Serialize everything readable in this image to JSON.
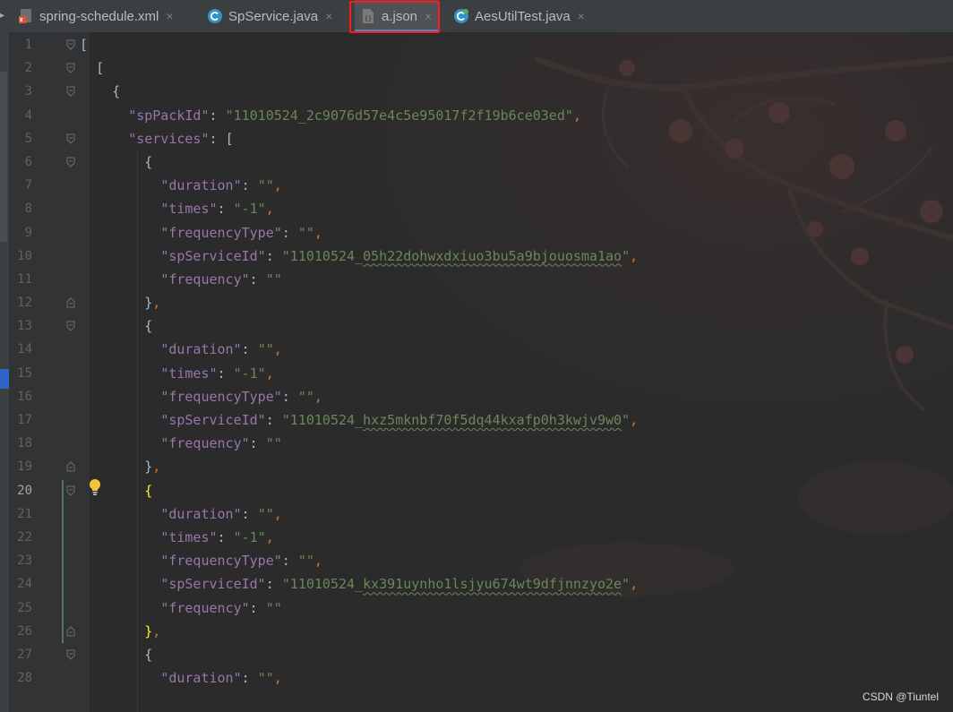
{
  "tabs": [
    {
      "label": "spring-schedule.xml",
      "icon": "xml-file-icon",
      "active": false
    },
    {
      "label": "SpService.java",
      "icon": "java-class-icon",
      "active": false
    },
    {
      "label": "a.json",
      "icon": "json-file-icon",
      "active": true
    },
    {
      "label": "AesUtilTest.java",
      "icon": "java-test-class-icon",
      "active": false
    }
  ],
  "tab_close_glyph": "×",
  "editor": {
    "lines": [
      {
        "n": "1",
        "text": "["
      },
      {
        "n": "2",
        "text": "  ["
      },
      {
        "n": "3",
        "text": "    {"
      },
      {
        "n": "4",
        "key": "spPackId",
        "value": "11010524_2c9076d57e4c5e95017f2f19b6ce03ed",
        "indent": "      ",
        "trail": ","
      },
      {
        "n": "5",
        "key": "services",
        "raw_after": "[",
        "indent": "      "
      },
      {
        "n": "6",
        "text": "        {"
      },
      {
        "n": "7",
        "key": "duration",
        "value": "",
        "indent": "          ",
        "trail": ","
      },
      {
        "n": "8",
        "key": "times",
        "value": "-1",
        "indent": "          ",
        "trail": ","
      },
      {
        "n": "9",
        "key": "frequencyType",
        "value": "",
        "indent": "          ",
        "trail": ","
      },
      {
        "n": "10",
        "key": "spServiceId",
        "value": "11010524_05h22dohwxdxiuo3bu5a9bjouosma1ao",
        "indent": "          ",
        "trail": ","
      },
      {
        "n": "11",
        "key": "frequency",
        "value": "",
        "indent": "          ",
        "trail": ""
      },
      {
        "n": "12",
        "text": "        },"
      },
      {
        "n": "13",
        "text": "        {"
      },
      {
        "n": "14",
        "key": "duration",
        "value": "",
        "indent": "          ",
        "trail": ","
      },
      {
        "n": "15",
        "key": "times",
        "value": "-1",
        "indent": "          ",
        "trail": ","
      },
      {
        "n": "16",
        "key": "frequencyType",
        "value": "",
        "indent": "          ",
        "trail": ","
      },
      {
        "n": "17",
        "key": "spServiceId",
        "value": "11010524_hxz5mknbf70f5dq44kxafp0h3kwjv9w0",
        "indent": "          ",
        "trail": ","
      },
      {
        "n": "18",
        "key": "frequency",
        "value": "",
        "indent": "          ",
        "trail": ""
      },
      {
        "n": "19",
        "text": "        },"
      },
      {
        "n": "20",
        "text": "        {",
        "current": true
      },
      {
        "n": "21",
        "key": "duration",
        "value": "",
        "indent": "          ",
        "trail": ","
      },
      {
        "n": "22",
        "key": "times",
        "value": "-1",
        "indent": "          ",
        "trail": ","
      },
      {
        "n": "23",
        "key": "frequencyType",
        "value": "",
        "indent": "          ",
        "trail": ","
      },
      {
        "n": "24",
        "key": "spServiceId",
        "value": "11010524_kx391uynho1lsjyu674wt9dfjnnzyo2e",
        "indent": "          ",
        "trail": ","
      },
      {
        "n": "25",
        "key": "frequency",
        "value": "",
        "indent": "          ",
        "trail": ""
      },
      {
        "n": "26",
        "text": "        },",
        "match": true
      },
      {
        "n": "27",
        "text": "        {"
      },
      {
        "n": "28",
        "key": "duration",
        "value": "",
        "indent": "          ",
        "trail": ","
      }
    ]
  },
  "watermark": "CSDN @Tiuntel",
  "colors": {
    "background": "#2b2b2b",
    "json_key": "#9876aa",
    "json_string": "#6a8759",
    "punctuation": "#a9b7c6",
    "comma": "#cc7832",
    "brace_match": "#ffef28",
    "highlight_box": "#ff1a1a"
  }
}
